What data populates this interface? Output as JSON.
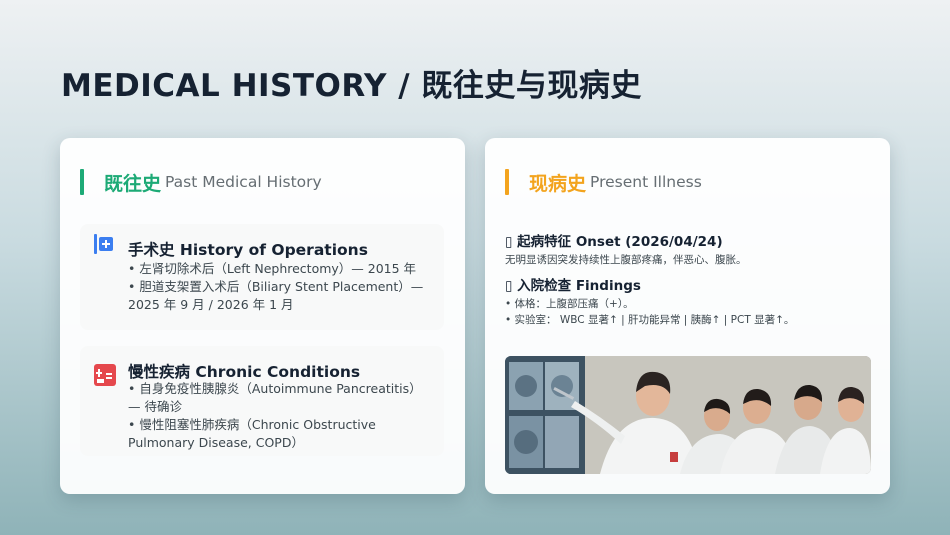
{
  "title": "MEDICAL HISTORY /  既往史与现病史",
  "past": {
    "title_zh": "既往史",
    "title_en": "Past Medical History",
    "operations": {
      "icon": "medical-plus-icon",
      "title": "手术史  History of Operations",
      "items": [
        "• 左肾切除术后（Left Nephrectomy）— 2015 年",
        "• 胆道支架置入术后（Biliary Stent Placement）— 2025 年 9 月 / 2026 年 1 月"
      ]
    },
    "chronic": {
      "icon": "hospital-icon",
      "title": "慢性疾病  Chronic Conditions",
      "items": [
        "• 自身免疫性胰腺炎（Autoimmune Pancreatitis）— 待确诊",
        "• 慢性阻塞性肺疾病（Chronic Obstructive Pulmonary Disease, COPD）"
      ]
    }
  },
  "present": {
    "title_zh": "现病史",
    "title_en": "Present Illness",
    "onset": {
      "title": "▯  起病特征  Onset (2026/04/24)",
      "text": "无明显诱因突发持续性上腹部疼痛，伴恶心、腹胀。"
    },
    "findings": {
      "title": "▯  入院检查  Findings",
      "items": [
        "• 体格：上腹部压痛（+）。",
        "• 实验室： WBC 显著↑  |  肝功能异常  |  胰酶↑  | PCT 显著↑。"
      ]
    },
    "photo": "doctors-reviewing-scans-photo"
  },
  "colors": {
    "past_accent": "#1daa76",
    "present_accent": "#f3a41e",
    "icon_blue": "#3b7ef0",
    "icon_red": "#e5484d"
  }
}
